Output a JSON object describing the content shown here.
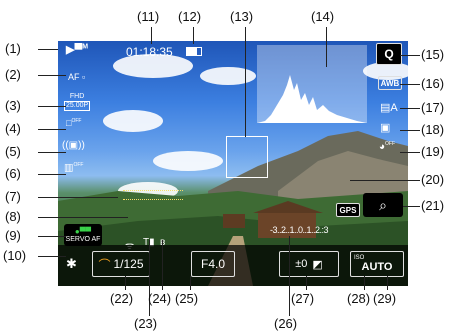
{
  "callouts": [
    "(1)",
    "(2)",
    "(3)",
    "(4)",
    "(5)",
    "(6)",
    "(7)",
    "(8)",
    "(9)",
    "(10)",
    "(11)",
    "(12)",
    "(13)",
    "(14)",
    "(15)",
    "(16)",
    "(17)",
    "(18)",
    "(19)",
    "(20)",
    "(21)",
    "(22)",
    "(23)",
    "(24)",
    "(25)",
    "(26)",
    "(27)",
    "(28)",
    "(29)"
  ],
  "osd": {
    "timecode": "01:18:35",
    "af_mode": "AF",
    "movie_quality_top": "FHD",
    "movie_quality_bottom": "25.00P",
    "servo_af": "SERVO AF",
    "shutter": "1/125",
    "aperture": "F4.0",
    "exposure_scale": "-3..2..1..0..1..2.:3",
    "exp_comp": "±0",
    "iso_label": "ISO",
    "iso_value": "AUTO",
    "wb": "AWB",
    "q_button": "Q",
    "gps": "GPS",
    "off_label": "OFF",
    "movie_m": "M"
  },
  "colors": {
    "accent_green": "#39d24a",
    "orange": "#f0a020",
    "osd_white": "#ffffff"
  }
}
